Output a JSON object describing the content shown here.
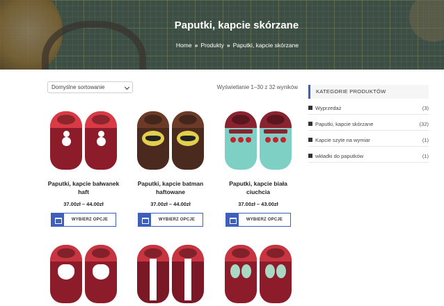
{
  "hero": {
    "title": "Paputki, kapcie skórzane",
    "breadcrumb": [
      "Home",
      "Produkty",
      "Paputki, kapcie skórzane"
    ],
    "separator": "»"
  },
  "toolbar": {
    "sort_selected": "Domyślne sortowanie",
    "result_count": "Wyświetlanie 1–30 z 32 wyników"
  },
  "products": [
    {
      "name": "Paputki, kapcie bałwanek haft",
      "price": "37.00zł – 44.00zł",
      "button": "WYBIERZ OPCJE",
      "shoe_color": "#8c1c2a",
      "cuff_color": "#d93a45",
      "deco": "snowman"
    },
    {
      "name": "Paputki, kapcie batman haftowane",
      "price": "37.00zł – 44.00zł",
      "button": "WYBIERZ OPCJE",
      "shoe_color": "#4a2a1e",
      "cuff_color": "#6b3b28",
      "deco": "bat"
    },
    {
      "name": "Paputki, kapcie biała ciuchcia",
      "price": "37.00zł – 43.00zł",
      "button": "WYBIERZ OPCJE",
      "shoe_color": "#7fd0c4",
      "cuff_color": "#8b2230",
      "deco": "train"
    },
    {
      "name": "",
      "price": "",
      "button": "",
      "shoe_color": "#8c1c2a",
      "cuff_color": "#c8343f",
      "deco": "cat"
    },
    {
      "name": "",
      "price": "",
      "button": "",
      "shoe_color": "#7a1826",
      "cuff_color": "#c8343f",
      "deco": "stripe"
    },
    {
      "name": "",
      "price": "",
      "button": "",
      "shoe_color": "#8c1c2a",
      "cuff_color": "#c8343f",
      "deco": "butterfly"
    }
  ],
  "sidebar": {
    "heading": "KATEGORIE PRODUKTÓW",
    "categories": [
      {
        "name": "Wyprzedaż",
        "count": "(3)"
      },
      {
        "name": "Paputki, kapcie skórzane",
        "count": "(32)"
      },
      {
        "name": "Kapcie szyte na wymiar",
        "count": "(1)"
      },
      {
        "name": "wkładki do paputków",
        "count": "(1)"
      }
    ]
  },
  "colors": {
    "accent": "#3f5fbd",
    "text": "#222222"
  }
}
